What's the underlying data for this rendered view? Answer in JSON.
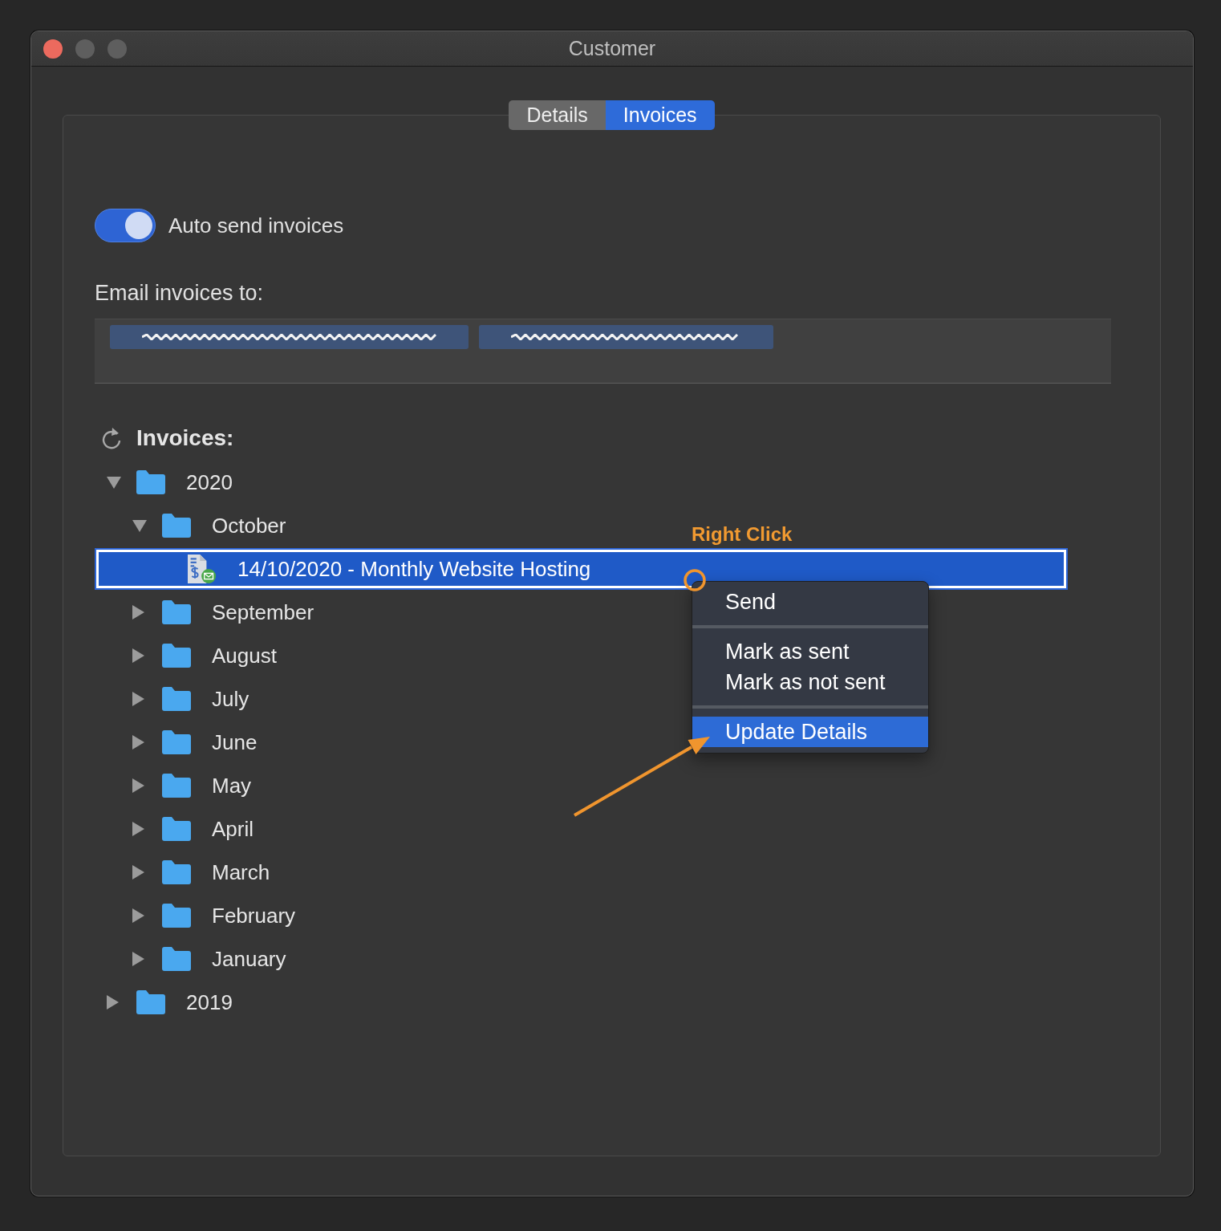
{
  "window": {
    "title": "Customer"
  },
  "tabs": [
    {
      "label": "Details",
      "selected": false
    },
    {
      "label": "Invoices",
      "selected": true
    }
  ],
  "auto_send": {
    "label": "Auto send invoices",
    "on": true
  },
  "email": {
    "label": "Email invoices to:",
    "recipients": [
      {
        "kind": "redacted"
      },
      {
        "kind": "redacted"
      }
    ]
  },
  "invoices": {
    "heading": "Invoices:",
    "tree": [
      {
        "label": "2020",
        "kind": "folder",
        "expanded": true,
        "selected": false,
        "children": [
          {
            "label": "October",
            "kind": "folder",
            "expanded": true,
            "selected": false,
            "children": [
              {
                "label": "14/10/2020 - Monthly Website Hosting",
                "kind": "invoice",
                "selected": true
              }
            ]
          },
          {
            "label": "September",
            "kind": "folder",
            "expanded": false,
            "selected": false
          },
          {
            "label": "August",
            "kind": "folder",
            "expanded": false,
            "selected": false
          },
          {
            "label": "July",
            "kind": "folder",
            "expanded": false,
            "selected": false
          },
          {
            "label": "June",
            "kind": "folder",
            "expanded": false,
            "selected": false
          },
          {
            "label": "May",
            "kind": "folder",
            "expanded": false,
            "selected": false
          },
          {
            "label": "April",
            "kind": "folder",
            "expanded": false,
            "selected": false
          },
          {
            "label": "March",
            "kind": "folder",
            "expanded": false,
            "selected": false
          },
          {
            "label": "February",
            "kind": "folder",
            "expanded": false,
            "selected": false
          },
          {
            "label": "January",
            "kind": "folder",
            "expanded": false,
            "selected": false
          }
        ]
      },
      {
        "label": "2019",
        "kind": "folder",
        "expanded": false,
        "selected": false
      }
    ]
  },
  "context_menu": {
    "groups": [
      {
        "items": [
          {
            "label": "Send",
            "selected": false
          }
        ]
      },
      {
        "items": [
          {
            "label": "Mark as sent",
            "selected": false
          },
          {
            "label": "Mark as not sent",
            "selected": false
          }
        ]
      },
      {
        "items": [
          {
            "label": "Update Details",
            "selected": true
          }
        ]
      }
    ]
  },
  "annotation": {
    "label": "Right Click"
  }
}
